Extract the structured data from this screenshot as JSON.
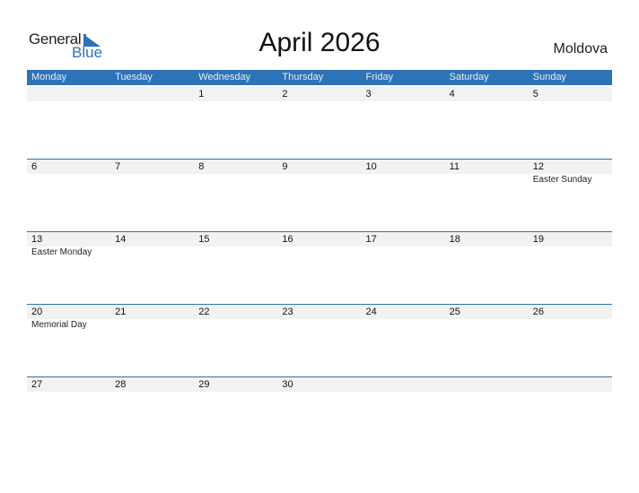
{
  "logo": {
    "general": "General",
    "blue": "Blue"
  },
  "title": "April 2026",
  "country": "Moldova",
  "colors": {
    "accent": "#2e72b8",
    "row_bg": "#f2f2f2"
  },
  "weekdays": [
    "Monday",
    "Tuesday",
    "Wednesday",
    "Thursday",
    "Friday",
    "Saturday",
    "Sunday"
  ],
  "weeks": [
    {
      "days": [
        "",
        "",
        "1",
        "2",
        "3",
        "4",
        "5"
      ],
      "events": [
        "",
        "",
        "",
        "",
        "",
        "",
        ""
      ]
    },
    {
      "days": [
        "6",
        "7",
        "8",
        "9",
        "10",
        "11",
        "12"
      ],
      "events": [
        "",
        "",
        "",
        "",
        "",
        "",
        "Easter Sunday"
      ]
    },
    {
      "days": [
        "13",
        "14",
        "15",
        "16",
        "17",
        "18",
        "19"
      ],
      "events": [
        "Easter Monday",
        "",
        "",
        "",
        "",
        "",
        ""
      ]
    },
    {
      "days": [
        "20",
        "21",
        "22",
        "23",
        "24",
        "25",
        "26"
      ],
      "events": [
        "Memorial Day",
        "",
        "",
        "",
        "",
        "",
        ""
      ]
    },
    {
      "days": [
        "27",
        "28",
        "29",
        "30",
        "",
        "",
        ""
      ],
      "events": [
        "",
        "",
        "",
        "",
        "",
        "",
        ""
      ]
    }
  ]
}
